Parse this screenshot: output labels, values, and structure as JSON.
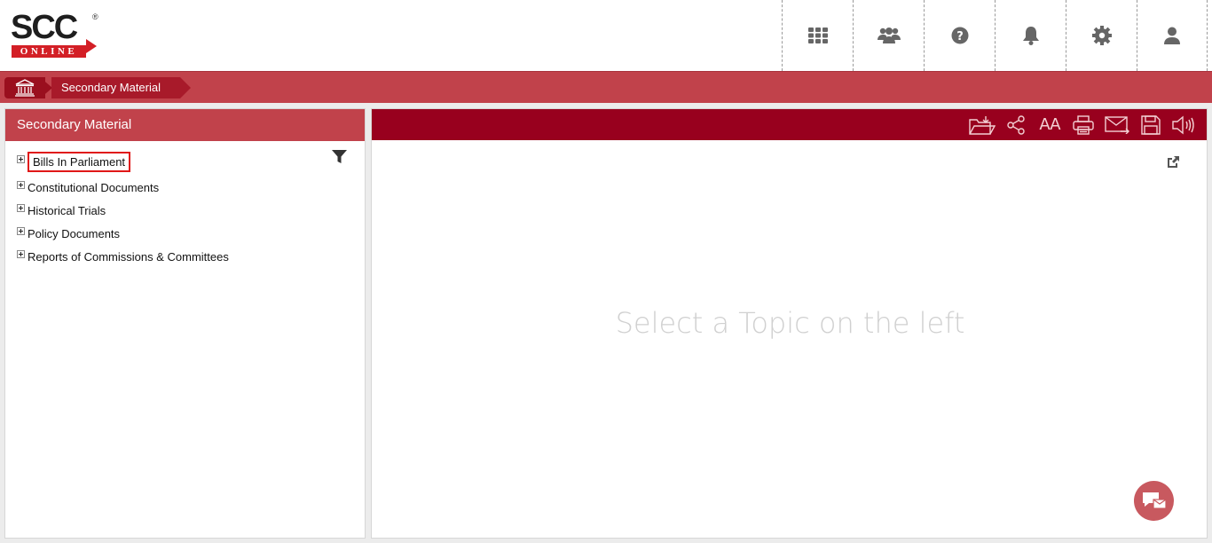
{
  "logo": {
    "main": "SCC",
    "sub": "ONLINE",
    "reg": "®"
  },
  "header_icons": [
    "apps-grid-icon",
    "users-icon",
    "help-icon",
    "bell-icon",
    "gear-icon",
    "user-icon"
  ],
  "breadcrumb": {
    "home_icon": "institution-icon",
    "current": "Secondary Material"
  },
  "left_panel": {
    "title": "Secondary Material",
    "tree": [
      {
        "label": "Bills In Parliament",
        "selected": true
      },
      {
        "label": "Constitutional Documents"
      },
      {
        "label": "Historical Trials"
      },
      {
        "label": "Policy Documents"
      },
      {
        "label": "Reports of Commissions & Committees"
      }
    ]
  },
  "toolbar": {
    "font_size_label": "AA"
  },
  "right_panel": {
    "placeholder": "Select a Topic on the left"
  },
  "colors": {
    "brand_red": "#c1424b",
    "toolbar_red": "#98001e",
    "logo_red": "#d31f26"
  }
}
